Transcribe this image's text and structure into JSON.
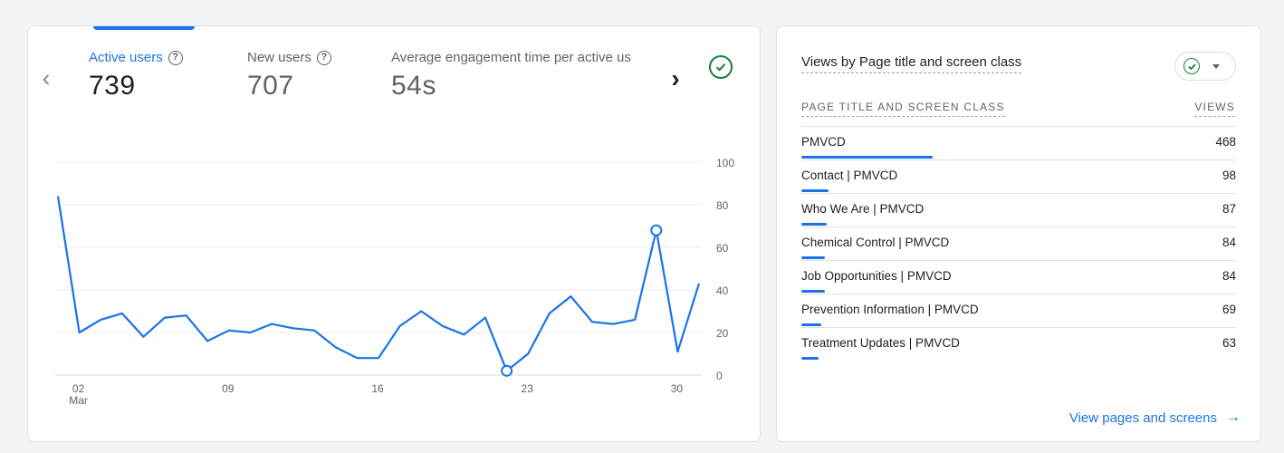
{
  "overview": {
    "metrics": [
      {
        "label": "Active users",
        "value": "739"
      },
      {
        "label": "New users",
        "value": "707"
      },
      {
        "label": "Average engagement time per active us",
        "value": "54s"
      }
    ]
  },
  "chart_data": {
    "type": "line",
    "x_tick_labels": [
      "02",
      "09",
      "16",
      "23",
      "30"
    ],
    "x_sublabel": "Mar",
    "y_ticks": [
      "100",
      "80",
      "60",
      "40",
      "20",
      "0"
    ],
    "ylim": [
      0,
      100
    ],
    "series": [
      {
        "values": [
          84,
          20,
          26,
          29,
          18,
          27,
          28,
          16,
          21,
          20,
          24,
          22,
          21,
          13,
          8,
          8,
          23,
          30,
          23,
          19,
          27,
          2,
          10,
          29,
          37,
          25,
          24,
          26,
          68,
          11,
          43
        ],
        "color": "#1a73e8"
      }
    ],
    "highlighted_points": [
      21,
      28
    ]
  },
  "views_card": {
    "title": "Views by Page title and screen class",
    "col_left": "PAGE TITLE AND SCREEN CLASS",
    "col_right": "VIEWS",
    "rows": [
      {
        "label": "PMVCD",
        "value": "468",
        "bar": 1.0
      },
      {
        "label": "Contact | PMVCD",
        "value": "98",
        "bar": 0.21
      },
      {
        "label": "Who We Are | PMVCD",
        "value": "87",
        "bar": 0.19
      },
      {
        "label": "Chemical Control | PMVCD",
        "value": "84",
        "bar": 0.18
      },
      {
        "label": "Job Opportunities | PMVCD",
        "value": "84",
        "bar": 0.18
      },
      {
        "label": "Prevention Information | PMVCD",
        "value": "69",
        "bar": 0.15
      },
      {
        "label": "Treatment Updates | PMVCD",
        "value": "63",
        "bar": 0.13
      }
    ],
    "link": "View pages and screens"
  },
  "colors": {
    "accent": "#1a73e8",
    "success": "#188038"
  }
}
